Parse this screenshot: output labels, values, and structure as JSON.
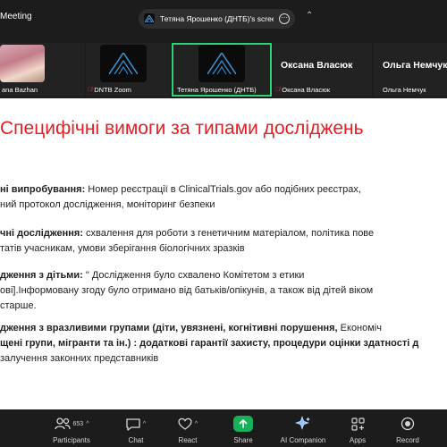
{
  "window": {
    "title": "Meeting"
  },
  "share_pill": {
    "text": "Тетяна Ярошенко (ДНТБ)'s scree"
  },
  "participants": [
    {
      "name": "ana Bazhan",
      "muted": false
    },
    {
      "name": "DNTB Zoom",
      "muted": true
    },
    {
      "name": "Тетяна Ярошенко (ДНТБ)",
      "muted": false
    },
    {
      "display": "Оксана Власюк",
      "name": "Оксана Власюк",
      "muted": true
    },
    {
      "display": "Ольга Немчук",
      "name": "Ольга Немчук",
      "muted": false
    }
  ],
  "slide": {
    "title": "Специфічні вимоги за типами досліджень",
    "p1": {
      "bold": "ні випробування:",
      "rest": " Номер реєстрації в ClinicalTrials.gov або подібних реєстрах,",
      "line2": "ний протокол дослідження, моніторинг безпеки"
    },
    "p2": {
      "bold": "чні дослідження:",
      "rest": " схвалення для роботи з генетичним матеріалом, політика пове",
      "line2": "татів учасникам, умови зберігання біологічних зразків"
    },
    "p3": {
      "bold": "дження з дітьми:",
      "rest": " \" Дослідження було схвалено Комітетом з етики",
      "line2": "ові].Інформовану згоду було отримано від батьків/опікунів, а також від дітей віком",
      "line3": "старше."
    },
    "p4": {
      "bold": "дження з вразливими групами (діти, увязнені, когнітивні порушення,",
      "rest": " Економіч",
      "line2_tail": "щені групи, мігранти та ін.) :",
      "line2_bold": " додаткові гарантії захисту, процедури оцінки здатності д",
      "line3": "залучення законних представників"
    }
  },
  "toolbar": {
    "participants_label": "Participants",
    "participants_count": "653",
    "chat_label": "Chat",
    "react_label": "React",
    "share_label": "Share",
    "ai_label": "AI Companion",
    "apps_label": "Apps",
    "record_label": "Record"
  },
  "colors": {
    "accent_green": "#2fd178",
    "share_green": "#17b15a",
    "title_red": "#e31e24",
    "mute_red": "#e0292b"
  }
}
